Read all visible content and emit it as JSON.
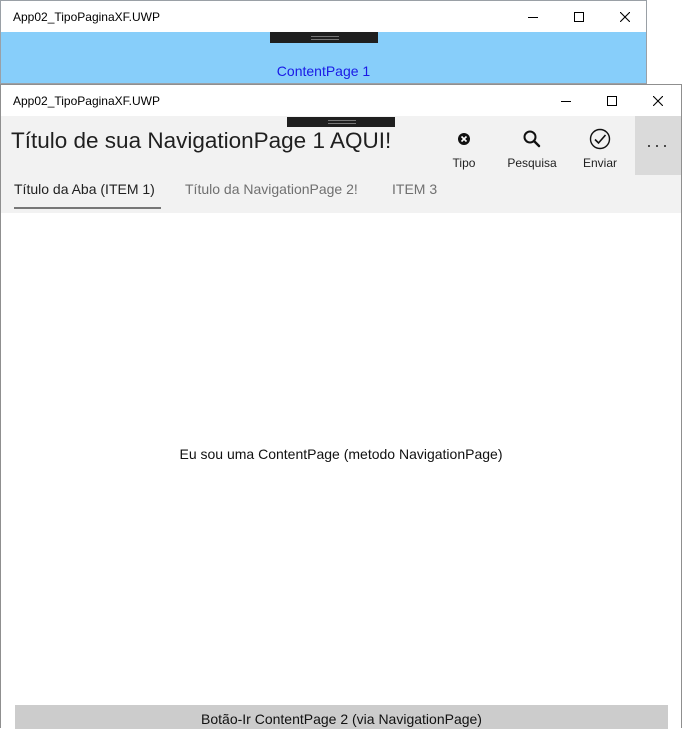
{
  "back_window": {
    "title": "App02_TipoPaginaXF.UWP",
    "content_label": "ContentPage 1",
    "colors": {
      "background": "#87cefa",
      "label": "#1a1ae6"
    }
  },
  "front_window": {
    "title": "App02_TipoPaginaXF.UWP",
    "nav_title": "Título de sua NavigationPage 1 AQUI!",
    "commands": [
      {
        "label": "Tipo",
        "icon": "close-circle-icon"
      },
      {
        "label": "Pesquisa",
        "icon": "search-icon"
      },
      {
        "label": "Enviar",
        "icon": "check-circle-icon"
      }
    ],
    "more_label": "···",
    "tabs": [
      {
        "label": "Título da Aba (ITEM 1)",
        "active": true
      },
      {
        "label": "Título da NavigationPage 2!",
        "active": false
      },
      {
        "label": "ITEM 3",
        "active": false
      }
    ],
    "body_text": "Eu sou uma ContentPage (metodo NavigationPage)",
    "bottom_button": "Botão-Ir ContentPage 2 (via NavigationPage)",
    "colors": {
      "navbar": "#f2f2f2",
      "more_button": "#dadada",
      "bottom_button": "#cccccc"
    }
  }
}
